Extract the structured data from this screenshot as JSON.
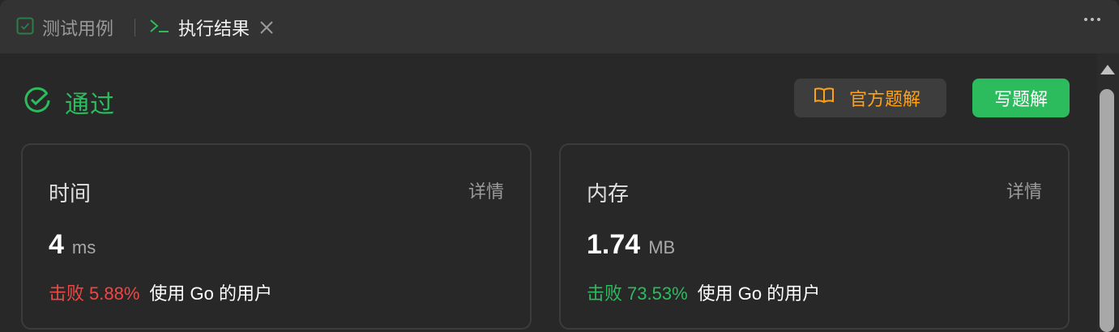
{
  "tabs": [
    {
      "label": "测试用例",
      "icon": "checkbox-icon",
      "active": false
    },
    {
      "label": "执行结果",
      "icon": "terminal-icon",
      "active": true
    }
  ],
  "status": {
    "label": "通过",
    "color": "#2cbb5d"
  },
  "actions": {
    "official_solutions": "官方题解",
    "write_solution": "写题解"
  },
  "stats": {
    "time": {
      "title": "时间",
      "detail": "详情",
      "value": "4",
      "unit": "ms",
      "beat_word": "击败",
      "beat_pct": "5.88%",
      "beat_tail": "使用 Go 的用户",
      "beat_color": "#ef4743"
    },
    "memory": {
      "title": "内存",
      "detail": "详情",
      "value": "1.74",
      "unit": "MB",
      "beat_word": "击败",
      "beat_pct": "73.53%",
      "beat_tail": "使用 Go 的用户",
      "beat_color": "#2cbb5d"
    }
  },
  "colors": {
    "accent_green": "#2cbb5d",
    "accent_orange": "#ffa116",
    "fail_red": "#ef4743"
  }
}
